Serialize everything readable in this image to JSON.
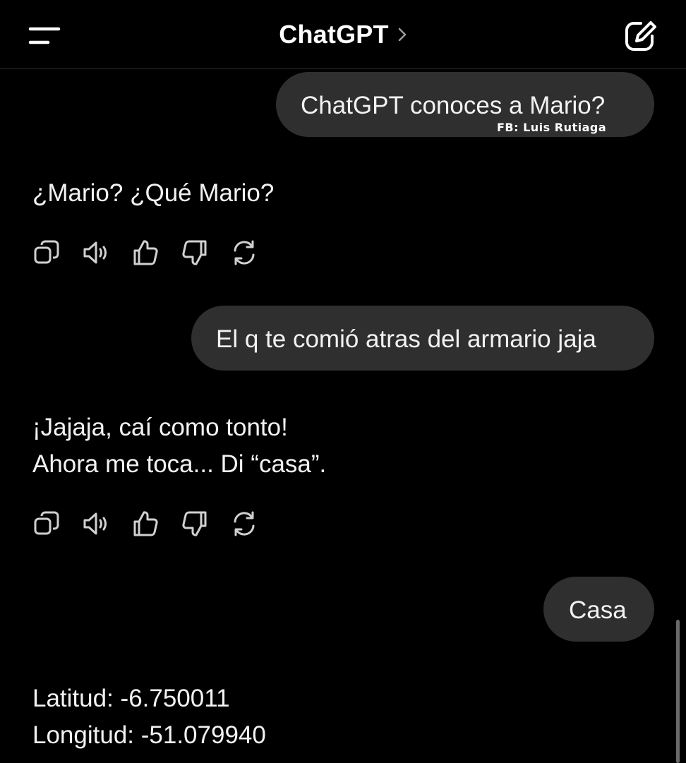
{
  "header": {
    "title": "ChatGPT",
    "menu_icon": "menu-icon",
    "chevron_icon": "chevron-right-icon",
    "new_chat_icon": "new-chat-icon"
  },
  "messages": [
    {
      "role": "user",
      "text": "ChatGPT conoces a Mario?",
      "watermark": "FB: Luis Rutiaga"
    },
    {
      "role": "assistant",
      "lines": [
        "¿Mario? ¿Qué Mario?"
      ]
    },
    {
      "role": "user",
      "text": "El q te comió atras del armario jaja"
    },
    {
      "role": "assistant",
      "lines": [
        "¡Jajaja, caí como tonto!",
        "Ahora me toca... Di “casa”."
      ]
    },
    {
      "role": "user",
      "text": "Casa"
    },
    {
      "role": "assistant",
      "lines": [
        "Latitud: -6.750011",
        "Longitud: -51.079940"
      ]
    }
  ],
  "actions": [
    "copy-icon",
    "speaker-icon",
    "thumbs-up-icon",
    "thumbs-down-icon",
    "regenerate-icon"
  ],
  "colors": {
    "background": "#000000",
    "bubble": "#2f2f2f",
    "text": "#ececec"
  }
}
